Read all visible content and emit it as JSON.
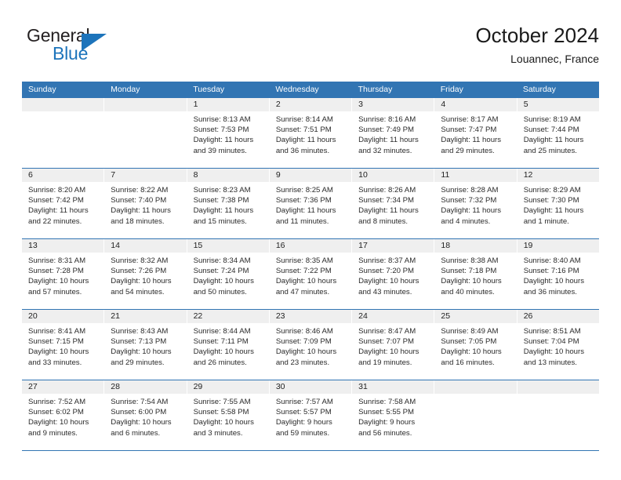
{
  "brand": {
    "word1": "General",
    "word2": "Blue",
    "logo_icon": "triangle-flag-icon",
    "accent_color": "#1d74bb"
  },
  "header": {
    "title": "October 2024",
    "subtitle": "Louannec, France"
  },
  "calendar": {
    "header_color": "#3275b3",
    "daynum_bg": "#efefef",
    "weekday_names": [
      "Sunday",
      "Monday",
      "Tuesday",
      "Wednesday",
      "Thursday",
      "Friday",
      "Saturday"
    ],
    "weeks": [
      [
        {
          "day": "",
          "sunrise": "",
          "sunset": "",
          "daylight": "",
          "empty": true
        },
        {
          "day": "",
          "sunrise": "",
          "sunset": "",
          "daylight": "",
          "empty": true
        },
        {
          "day": "1",
          "sunrise": "Sunrise: 8:13 AM",
          "sunset": "Sunset: 7:53 PM",
          "daylight": "Daylight: 11 hours and 39 minutes."
        },
        {
          "day": "2",
          "sunrise": "Sunrise: 8:14 AM",
          "sunset": "Sunset: 7:51 PM",
          "daylight": "Daylight: 11 hours and 36 minutes."
        },
        {
          "day": "3",
          "sunrise": "Sunrise: 8:16 AM",
          "sunset": "Sunset: 7:49 PM",
          "daylight": "Daylight: 11 hours and 32 minutes."
        },
        {
          "day": "4",
          "sunrise": "Sunrise: 8:17 AM",
          "sunset": "Sunset: 7:47 PM",
          "daylight": "Daylight: 11 hours and 29 minutes."
        },
        {
          "day": "5",
          "sunrise": "Sunrise: 8:19 AM",
          "sunset": "Sunset: 7:44 PM",
          "daylight": "Daylight: 11 hours and 25 minutes."
        }
      ],
      [
        {
          "day": "6",
          "sunrise": "Sunrise: 8:20 AM",
          "sunset": "Sunset: 7:42 PM",
          "daylight": "Daylight: 11 hours and 22 minutes."
        },
        {
          "day": "7",
          "sunrise": "Sunrise: 8:22 AM",
          "sunset": "Sunset: 7:40 PM",
          "daylight": "Daylight: 11 hours and 18 minutes."
        },
        {
          "day": "8",
          "sunrise": "Sunrise: 8:23 AM",
          "sunset": "Sunset: 7:38 PM",
          "daylight": "Daylight: 11 hours and 15 minutes."
        },
        {
          "day": "9",
          "sunrise": "Sunrise: 8:25 AM",
          "sunset": "Sunset: 7:36 PM",
          "daylight": "Daylight: 11 hours and 11 minutes."
        },
        {
          "day": "10",
          "sunrise": "Sunrise: 8:26 AM",
          "sunset": "Sunset: 7:34 PM",
          "daylight": "Daylight: 11 hours and 8 minutes."
        },
        {
          "day": "11",
          "sunrise": "Sunrise: 8:28 AM",
          "sunset": "Sunset: 7:32 PM",
          "daylight": "Daylight: 11 hours and 4 minutes."
        },
        {
          "day": "12",
          "sunrise": "Sunrise: 8:29 AM",
          "sunset": "Sunset: 7:30 PM",
          "daylight": "Daylight: 11 hours and 1 minute."
        }
      ],
      [
        {
          "day": "13",
          "sunrise": "Sunrise: 8:31 AM",
          "sunset": "Sunset: 7:28 PM",
          "daylight": "Daylight: 10 hours and 57 minutes."
        },
        {
          "day": "14",
          "sunrise": "Sunrise: 8:32 AM",
          "sunset": "Sunset: 7:26 PM",
          "daylight": "Daylight: 10 hours and 54 minutes."
        },
        {
          "day": "15",
          "sunrise": "Sunrise: 8:34 AM",
          "sunset": "Sunset: 7:24 PM",
          "daylight": "Daylight: 10 hours and 50 minutes."
        },
        {
          "day": "16",
          "sunrise": "Sunrise: 8:35 AM",
          "sunset": "Sunset: 7:22 PM",
          "daylight": "Daylight: 10 hours and 47 minutes."
        },
        {
          "day": "17",
          "sunrise": "Sunrise: 8:37 AM",
          "sunset": "Sunset: 7:20 PM",
          "daylight": "Daylight: 10 hours and 43 minutes."
        },
        {
          "day": "18",
          "sunrise": "Sunrise: 8:38 AM",
          "sunset": "Sunset: 7:18 PM",
          "daylight": "Daylight: 10 hours and 40 minutes."
        },
        {
          "day": "19",
          "sunrise": "Sunrise: 8:40 AM",
          "sunset": "Sunset: 7:16 PM",
          "daylight": "Daylight: 10 hours and 36 minutes."
        }
      ],
      [
        {
          "day": "20",
          "sunrise": "Sunrise: 8:41 AM",
          "sunset": "Sunset: 7:15 PM",
          "daylight": "Daylight: 10 hours and 33 minutes."
        },
        {
          "day": "21",
          "sunrise": "Sunrise: 8:43 AM",
          "sunset": "Sunset: 7:13 PM",
          "daylight": "Daylight: 10 hours and 29 minutes."
        },
        {
          "day": "22",
          "sunrise": "Sunrise: 8:44 AM",
          "sunset": "Sunset: 7:11 PM",
          "daylight": "Daylight: 10 hours and 26 minutes."
        },
        {
          "day": "23",
          "sunrise": "Sunrise: 8:46 AM",
          "sunset": "Sunset: 7:09 PM",
          "daylight": "Daylight: 10 hours and 23 minutes."
        },
        {
          "day": "24",
          "sunrise": "Sunrise: 8:47 AM",
          "sunset": "Sunset: 7:07 PM",
          "daylight": "Daylight: 10 hours and 19 minutes."
        },
        {
          "day": "25",
          "sunrise": "Sunrise: 8:49 AM",
          "sunset": "Sunset: 7:05 PM",
          "daylight": "Daylight: 10 hours and 16 minutes."
        },
        {
          "day": "26",
          "sunrise": "Sunrise: 8:51 AM",
          "sunset": "Sunset: 7:04 PM",
          "daylight": "Daylight: 10 hours and 13 minutes."
        }
      ],
      [
        {
          "day": "27",
          "sunrise": "Sunrise: 7:52 AM",
          "sunset": "Sunset: 6:02 PM",
          "daylight": "Daylight: 10 hours and 9 minutes."
        },
        {
          "day": "28",
          "sunrise": "Sunrise: 7:54 AM",
          "sunset": "Sunset: 6:00 PM",
          "daylight": "Daylight: 10 hours and 6 minutes."
        },
        {
          "day": "29",
          "sunrise": "Sunrise: 7:55 AM",
          "sunset": "Sunset: 5:58 PM",
          "daylight": "Daylight: 10 hours and 3 minutes."
        },
        {
          "day": "30",
          "sunrise": "Sunrise: 7:57 AM",
          "sunset": "Sunset: 5:57 PM",
          "daylight": "Daylight: 9 hours and 59 minutes."
        },
        {
          "day": "31",
          "sunrise": "Sunrise: 7:58 AM",
          "sunset": "Sunset: 5:55 PM",
          "daylight": "Daylight: 9 hours and 56 minutes."
        },
        {
          "day": "",
          "sunrise": "",
          "sunset": "",
          "daylight": "",
          "empty": true
        },
        {
          "day": "",
          "sunrise": "",
          "sunset": "",
          "daylight": "",
          "empty": true
        }
      ]
    ]
  }
}
